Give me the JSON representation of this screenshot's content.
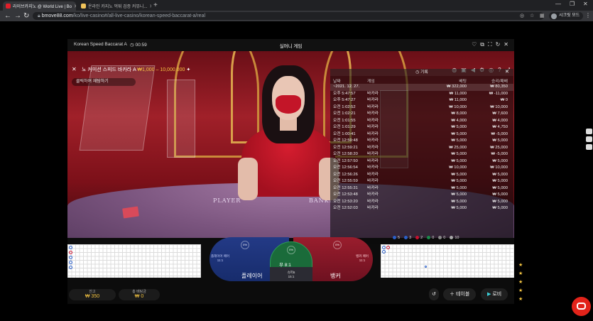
{
  "browser": {
    "tabs": [
      {
        "title": "라이브카지노 @ World Live | Bo",
        "active": true,
        "color": "#e01f2a"
      },
      {
        "title": "온라인 카지노 먹튀 검증 커뮤니...",
        "active": false,
        "color": "#f0c35a"
      }
    ],
    "url_domain": "bmove88.com",
    "url_path": "/ko/live-casino#/all-live-casino/korean-speed-baccarat-a/real",
    "profile_label": "시크릿 모드"
  },
  "game": {
    "header_title": "Korean Speed Baccarat A",
    "timer": "00:59",
    "center_title": "실머니 게임",
    "table_name": "노 커미션 스피드 바카라 A",
    "limits": "₩1,000 – 10,000,000",
    "redo_tab": "클릭하여 재탐하기",
    "felt_player": "PLAYER",
    "felt_banker": "BANKER"
  },
  "history": {
    "title": "기록",
    "columns": {
      "date": "날짜",
      "game": "게임",
      "bet": "배팅",
      "result": "승리/패배"
    },
    "rows": [
      {
        "date": "~2021. 12. 27.",
        "game": "",
        "bet": "₩ 322,000",
        "result": "₩ 80,350"
      },
      {
        "date": "오후 5:47:57",
        "game": "바카라",
        "bet": "₩ 11,000",
        "result": "₩ -11,000"
      },
      {
        "date": "오후 5:47:27",
        "game": "바카라",
        "bet": "₩ 11,000",
        "result": "₩ 0"
      },
      {
        "date": "오전 1:02:52",
        "game": "바카라",
        "bet": "₩ 10,000",
        "result": "₩ 10,000"
      },
      {
        "date": "오전 1:02:21",
        "game": "바카라",
        "bet": "₩ 8,000",
        "result": "₩ 7,600"
      },
      {
        "date": "오전 1:01:55",
        "game": "바카라",
        "bet": "₩ 4,000",
        "result": "₩ 4,000"
      },
      {
        "date": "오전 1:01:29",
        "game": "바카라",
        "bet": "₩ 5,000",
        "result": "₩ 4,750"
      },
      {
        "date": "오전 1:00:41",
        "game": "바카라",
        "bet": "₩ 5,000",
        "result": "₩ -5,000"
      },
      {
        "date": "오전 12:59:48",
        "game": "바카라",
        "bet": "₩ 5,000",
        "result": "₩ 5,000"
      },
      {
        "date": "오전 12:59:21",
        "game": "바카라",
        "bet": "₩ 25,000",
        "result": "₩ 25,000"
      },
      {
        "date": "오전 12:58:20",
        "game": "바카라",
        "bet": "₩ 5,000",
        "result": "₩ -5,000"
      },
      {
        "date": "오전 12:57:50",
        "game": "바카라",
        "bet": "₩ 5,000",
        "result": "₩ 5,000"
      },
      {
        "date": "오전 12:56:54",
        "game": "바카라",
        "bet": "₩ 10,000",
        "result": "₩ 10,000"
      },
      {
        "date": "오전 12:56:26",
        "game": "바카라",
        "bet": "₩ 5,000",
        "result": "₩ 5,000"
      },
      {
        "date": "오전 12:55:59",
        "game": "바카라",
        "bet": "₩ 5,000",
        "result": "₩ 5,000"
      },
      {
        "date": "오전 12:55:31",
        "game": "바카라",
        "bet": "₩ 5,000",
        "result": "₩ 5,000"
      },
      {
        "date": "오전 12:53:48",
        "game": "바카라",
        "bet": "₩ 5,000",
        "result": "₩ 5,000"
      },
      {
        "date": "오전 12:53:20",
        "game": "바카라",
        "bet": "₩ 5,000",
        "result": "₩ 5,000"
      },
      {
        "date": "오전 12:52:03",
        "game": "바카라",
        "bet": "₩ 5,000",
        "result": "₩ 5,000"
      }
    ]
  },
  "stats": [
    {
      "label": "5",
      "color": "#2a5fc9"
    },
    {
      "label": "3",
      "color": "#2a5fc9"
    },
    {
      "label": "2",
      "color": "#c8102e"
    },
    {
      "label": "0",
      "color": "#1a8a4a"
    },
    {
      "label": "0",
      "color": "#888888"
    },
    {
      "label": "10",
      "color": "#aaaaaa"
    }
  ],
  "betting": {
    "player_label": "플레이어",
    "banker_label": "뱅커",
    "tie_label": "무 8:1",
    "player_pair": "플레이어 페어\n11:1",
    "banker_pair": "뱅커 페어\n11:1",
    "super6": "슈퍼6\n15:1",
    "player_ring": "0%",
    "banker_ring": "0%",
    "tie_ring": "0%"
  },
  "footer": {
    "balance_label": "잔고",
    "balance_value": "₩ 350",
    "total_bet_label": "총 배팅금",
    "total_bet_value": "₩ 0",
    "table_button": "테이블",
    "lobby_button": "로비"
  },
  "accent_colors": {
    "gold": "#f5c542",
    "player_blue": "#2a5fc9",
    "banker_red": "#c8102e",
    "chat_red": "#e2231a"
  }
}
